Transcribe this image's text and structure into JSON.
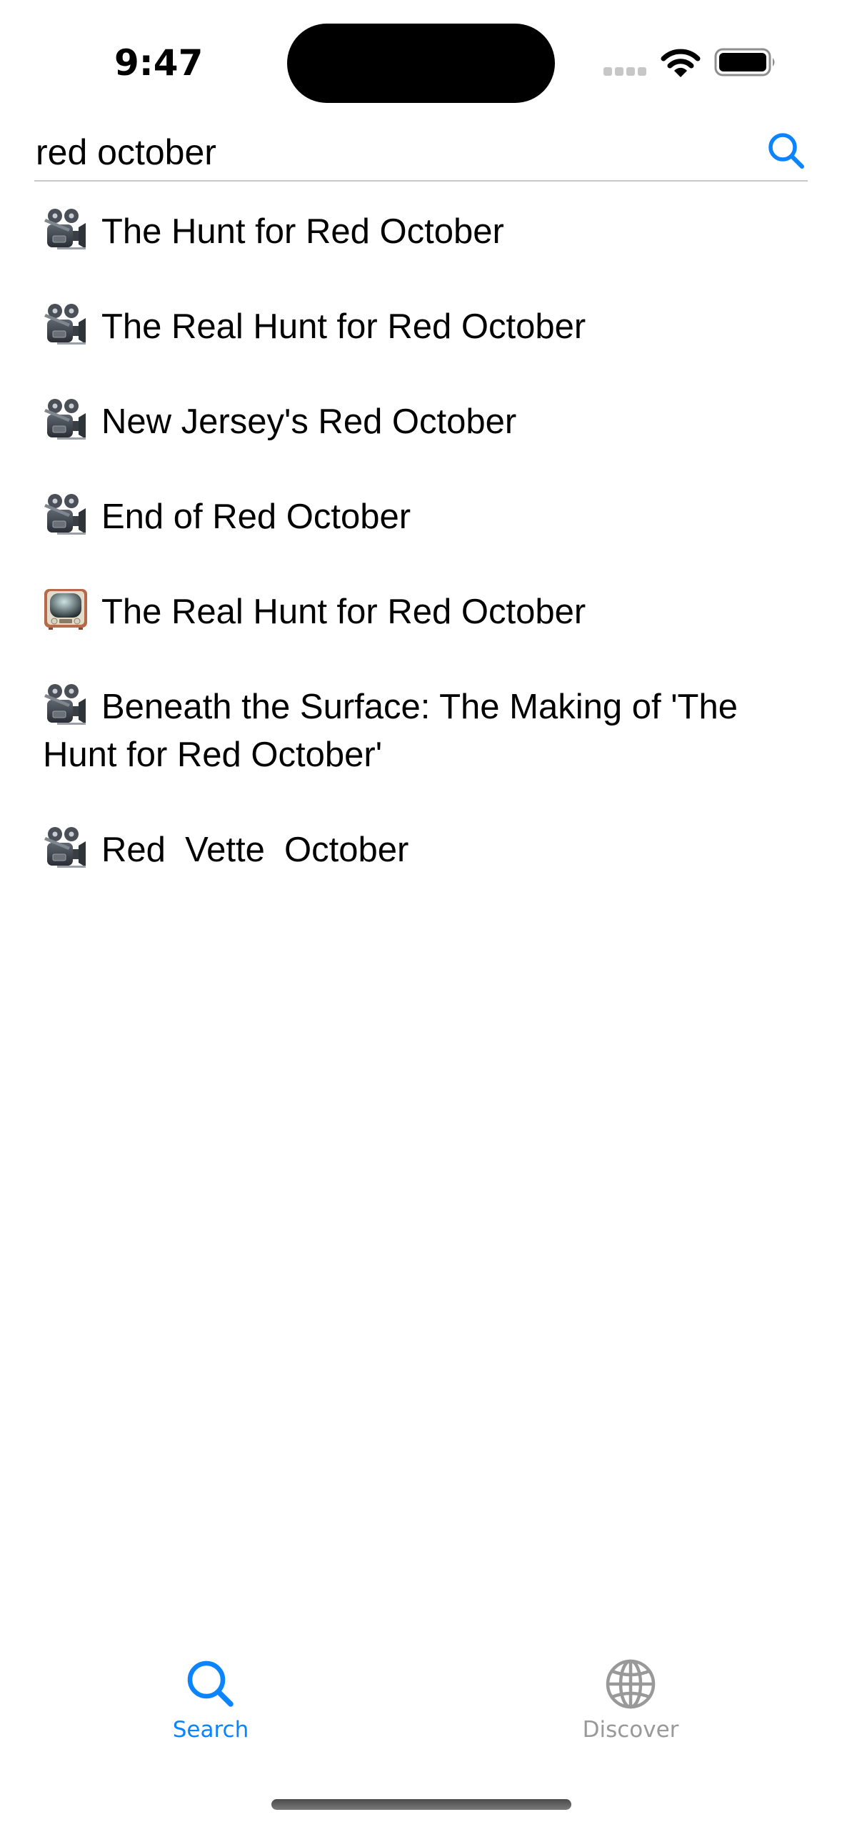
{
  "status_bar": {
    "time": "9:47",
    "signal_icon": "cellular-signal-icon",
    "wifi_icon": "wifi-icon",
    "battery_icon": "battery-full-icon"
  },
  "search": {
    "value": "red october",
    "placeholder": "",
    "button_icon": "search-icon",
    "accent_color": "#0a84ff"
  },
  "results": [
    {
      "icon": "movie-camera-icon",
      "title": "The Hunt for Red October"
    },
    {
      "icon": "movie-camera-icon",
      "title": "The Real Hunt for Red October"
    },
    {
      "icon": "movie-camera-icon",
      "title": "New Jersey's Red October"
    },
    {
      "icon": "movie-camera-icon",
      "title": "End of Red October"
    },
    {
      "icon": "television-icon",
      "title": "The Real Hunt for Red October"
    },
    {
      "icon": "movie-camera-icon",
      "title": "Beneath the Surface: The Making of 'The Hunt for Red October'"
    },
    {
      "icon": "movie-camera-icon",
      "title": "Red  Vette  October"
    }
  ],
  "tab_bar": {
    "tabs": [
      {
        "label": "Search",
        "icon": "search-icon",
        "selected": true,
        "color": "#0a84ff"
      },
      {
        "label": "Discover",
        "icon": "globe-icon",
        "selected": false,
        "color": "#999999"
      }
    ]
  }
}
